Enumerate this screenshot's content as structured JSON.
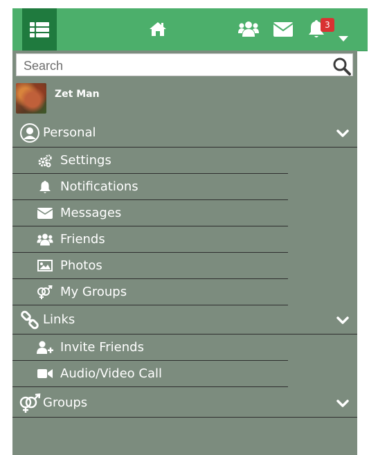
{
  "topbar": {
    "badge_count": "3",
    "icons": [
      "list-icon",
      "home-icon",
      "users-icon",
      "envelope-icon",
      "bell-icon",
      "caret-down-icon"
    ]
  },
  "search": {
    "placeholder": "Search"
  },
  "profile": {
    "name": "Zet Man"
  },
  "sections": {
    "personal": {
      "label": "Personal",
      "items": [
        {
          "label": "Settings",
          "icon": "gears-icon"
        },
        {
          "label": "Notifications",
          "icon": "bell-icon"
        },
        {
          "label": "Messages",
          "icon": "envelope-icon"
        },
        {
          "label": "Friends",
          "icon": "users-icon"
        },
        {
          "label": "Photos",
          "icon": "image-icon"
        },
        {
          "label": "My Groups",
          "icon": "venus-mars-icon"
        }
      ]
    },
    "links": {
      "label": "Links",
      "items": [
        {
          "label": "Invite Friends",
          "icon": "user-plus-icon"
        },
        {
          "label": "Audio/Video Call",
          "icon": "video-icon"
        }
      ]
    },
    "groups": {
      "label": "Groups"
    }
  },
  "colors": {
    "topbar": "#4caf6b",
    "menu_button": "#1f7a3e",
    "sidebar": "#7c8c7e",
    "badge": "#d93232"
  }
}
